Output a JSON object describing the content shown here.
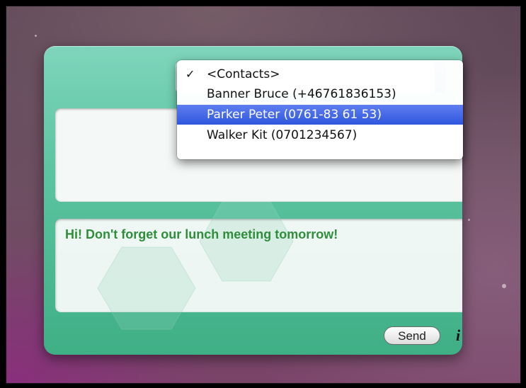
{
  "widget": {
    "contacts_menu": {
      "checkmark": "✓",
      "items": [
        {
          "label": "<Contacts>",
          "checked": true,
          "highlighted": false
        },
        {
          "label": "Banner Bruce (+46761836153)",
          "checked": false,
          "highlighted": false
        },
        {
          "label": "Parker Peter (0761-83 61 53)",
          "checked": false,
          "highlighted": true
        },
        {
          "label": "Walker Kit (0701234567)",
          "checked": false,
          "highlighted": false
        }
      ]
    },
    "to_field": {
      "value": ""
    },
    "message": {
      "value": "Hi! Don't forget our lunch meeting tomorrow!"
    },
    "send_label": "Send",
    "info_label": "i",
    "colors": {
      "widget_green": "#5cc4a1",
      "message_text": "#2e8e3a",
      "menu_highlight": "#3a5fe2"
    }
  }
}
